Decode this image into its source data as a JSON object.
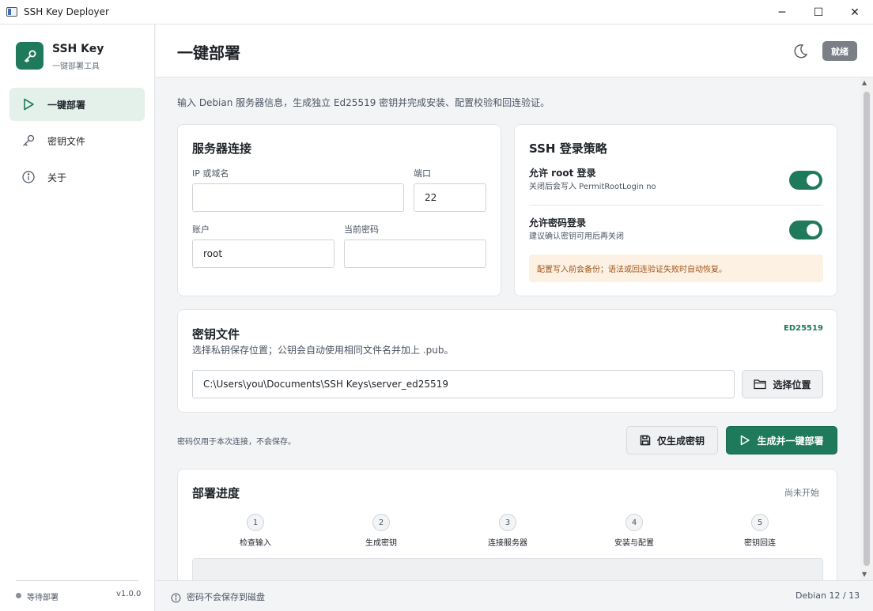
{
  "window": {
    "title": "SSH Key Deployer",
    "minimize": "─",
    "maximize": "☐",
    "close": "✕"
  },
  "sidebar": {
    "brand_name": "SSH Key",
    "brand_sub": "一键部署工具",
    "items": [
      {
        "label": "一键部署",
        "icon": "play-icon",
        "active": true
      },
      {
        "label": "密钥文件",
        "icon": "key-icon",
        "active": false
      },
      {
        "label": "关于",
        "icon": "info-icon",
        "active": false
      }
    ],
    "status": "等待部署",
    "version": "v1.0.0"
  },
  "header": {
    "title": "一键部署",
    "badge": "就绪"
  },
  "intro": "输入 Debian 服务器信息，生成独立 Ed25519 密钥并完成安装、配置校验和回连验证。",
  "server": {
    "title": "服务器连接",
    "host_label": "IP 或域名",
    "host_value": "",
    "port_label": "端口",
    "port_value": "22",
    "user_label": "账户",
    "user_value": "root",
    "password_label": "当前密码",
    "password_value": ""
  },
  "policy": {
    "title": "SSH 登录策略",
    "root_title": "允许 root 登录",
    "root_sub": "关闭后会写入 PermitRootLogin no",
    "root_enabled": true,
    "pw_title": "允许密码登录",
    "pw_sub": "建议确认密钥可用后再关闭",
    "pw_enabled": true,
    "warning": "配置写入前会备份；语法或回连验证失败时自动恢复。"
  },
  "keyfile": {
    "title": "密钥文件",
    "badge": "ED25519",
    "desc": "选择私钥保存位置；公钥会自动使用相同文件名并加上 .pub。",
    "path": "C:\\Users\\you\\Documents\\SSH Keys\\server_ed25519",
    "choose_label": "选择位置"
  },
  "actions": {
    "note": "密码仅用于本次连接，不会保存。",
    "gen_only": "仅生成密钥",
    "gen_deploy": "生成并一键部署"
  },
  "progress": {
    "title": "部署进度",
    "state": "尚未开始",
    "steps": [
      {
        "num": "1",
        "label": "检查输入"
      },
      {
        "num": "2",
        "label": "生成密钥"
      },
      {
        "num": "3",
        "label": "连接服务器"
      },
      {
        "num": "4",
        "label": "安装与配置"
      },
      {
        "num": "5",
        "label": "密钥回连"
      }
    ]
  },
  "footer": {
    "note": "密码不会保存到磁盘",
    "os": "Debian 12 / 13"
  },
  "colors": {
    "accent": "#1e7a5a",
    "badge": "#7b8087",
    "warning_bg": "#fdf1e3",
    "warning_text": "#a4561c"
  }
}
